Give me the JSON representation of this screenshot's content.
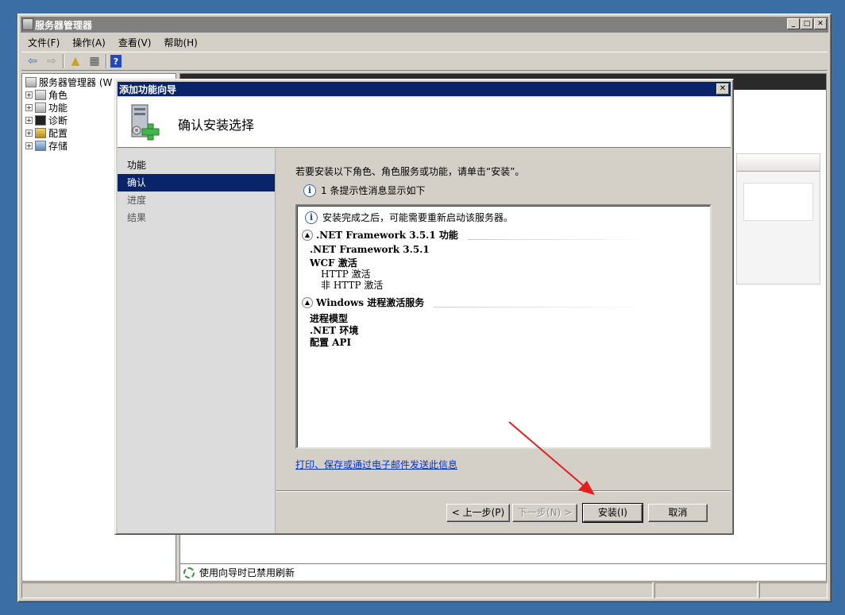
{
  "window": {
    "title": "服务器管理器"
  },
  "menu": [
    "文件(F)",
    "操作(A)",
    "查看(V)",
    "帮助(H)"
  ],
  "tree": {
    "root": "服务器管理器 (W",
    "items": [
      "角色",
      "功能",
      "诊断",
      "配置",
      "存储"
    ]
  },
  "right_pane": {
    "status_text": "使用向导时已禁用刷新"
  },
  "dialog": {
    "title": "添加功能向导",
    "header_title": "确认安装选择",
    "nav": [
      "功能",
      "确认",
      "进度",
      "结果"
    ],
    "active_nav": "确认",
    "intro": "若要安装以下角色、角色服务或功能，请单击“安装”。",
    "info_message": "1 条提示性消息显示如下",
    "summary": {
      "restart_note": "安装完成之后，可能需要重新启动该服务器。",
      "sections": [
        {
          "title": ".NET Framework 3.5.1 功能",
          "items": [
            ".NET Framework 3.5.1",
            "WCF 激活",
            "HTTP 激活",
            "非 HTTP 激活"
          ]
        },
        {
          "title": "Windows 进程激活服务",
          "items": [
            "进程模型",
            ".NET 环境",
            "配置 API"
          ]
        }
      ]
    },
    "link": "打印、保存或通过电子邮件发送此信息",
    "buttons": {
      "prev": "< 上一步(P)",
      "next": "下一步(N) >",
      "install": "安装(I)",
      "cancel": "取消"
    }
  },
  "colors": {
    "desktop": "#3a6ea5",
    "active_title": "#0a246a",
    "annotation_arrow": "#e02020"
  }
}
